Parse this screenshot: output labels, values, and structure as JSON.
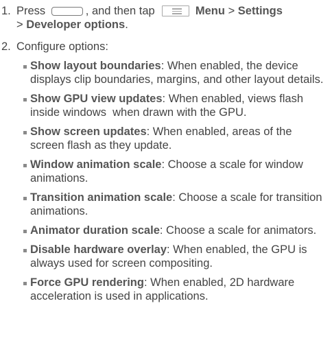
{
  "steps": [
    {
      "number": "1.",
      "press_text": "Press",
      "home_key_icon": "home-key-icon",
      "then_text": ", and then tap",
      "menu_key_icon": "menu-key-icon",
      "menu_label": "Menu",
      "separator_1": " > ",
      "settings_label": "Settings",
      "separator_2": "> ",
      "developer_label": "Developer options",
      "end_punct": "."
    },
    {
      "number": "2.",
      "text": "Configure options:"
    }
  ],
  "options": [
    {
      "term": "Show layout boundaries",
      "description": ": When enabled, the device displays clip boundaries, margins, and other layout details."
    },
    {
      "term": "Show GPU view updates",
      "description": ": When enabled, views flash inside windows  when drawn with the GPU."
    },
    {
      "term": "Show screen updates",
      "description": ": When enabled, areas of the screen flash as they update."
    },
    {
      "term": "Window animation scale",
      "description": ": Choose a scale for window animations."
    },
    {
      "term": "Transition animation scale",
      "description": ": Choose a scale for transition animations."
    },
    {
      "term": "Animator duration scale",
      "description": ": Choose a scale for animators."
    },
    {
      "term": "Disable hardware overlay",
      "description": ": When enabled, the GPU is always used for screen compositing."
    },
    {
      "term": "Force GPU rendering",
      "description": ": When enabled, 2D hardware acceleration is used in applications."
    }
  ]
}
